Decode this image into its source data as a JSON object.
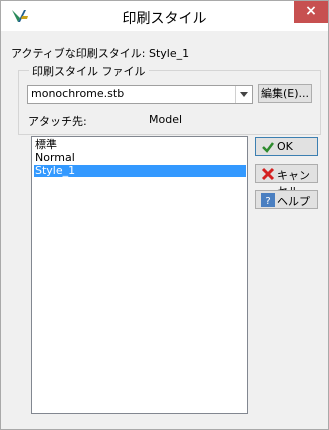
{
  "window": {
    "title": "印刷スタイル",
    "close_glyph": "×"
  },
  "active_style": {
    "label": "アクティブな印刷スタイル:",
    "value": "Style_1"
  },
  "group": {
    "legend": "印刷スタイル ファイル",
    "combo_value": "monochrome.stb",
    "edit_label": "編集(E)...",
    "attach_label": "アタッチ先:",
    "attach_value": "Model"
  },
  "list": {
    "items": [
      "標準",
      "Normal",
      "Style_1"
    ],
    "selected_index": 2
  },
  "buttons": {
    "ok": "OK",
    "cancel": "キャンセル",
    "help": "ヘルプ"
  },
  "colors": {
    "selection": "#3399ff",
    "close": "#c75050",
    "ok_check": "#2e8b2e",
    "cancel_x": "#d42020",
    "help_bg": "#4a7fc1"
  }
}
